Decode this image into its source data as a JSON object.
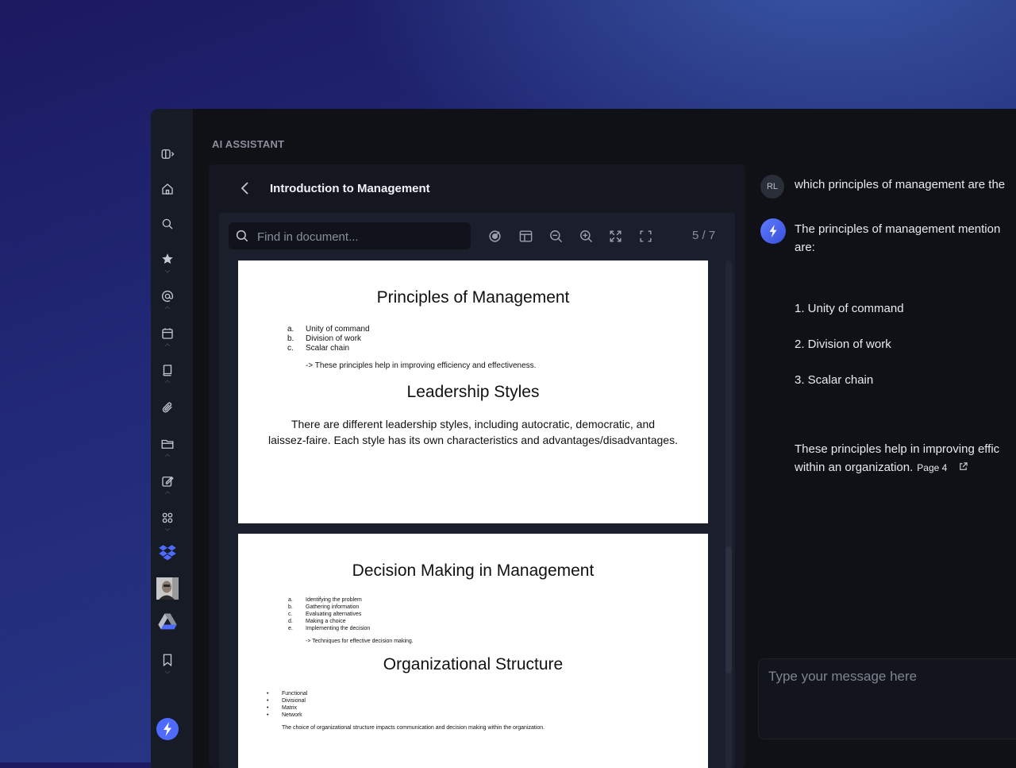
{
  "app_title": "AI ASSISTANT",
  "sidebar": {
    "items": [
      {
        "icon": "sidebar-toggle-icon"
      },
      {
        "icon": "home-icon"
      },
      {
        "icon": "search-icon"
      },
      {
        "icon": "star-icon"
      },
      {
        "icon": "at-sign-icon"
      },
      {
        "icon": "calendar-icon"
      },
      {
        "icon": "book-icon"
      },
      {
        "icon": "paperclip-icon"
      },
      {
        "icon": "folder-icon"
      },
      {
        "icon": "edit-icon"
      },
      {
        "icon": "apps-grid-icon"
      },
      {
        "icon": "dropbox-icon"
      },
      {
        "icon": "user-avatar"
      },
      {
        "icon": "google-drive-icon"
      },
      {
        "icon": "bookmark-icon"
      },
      {
        "icon": "ai-assistant-icon"
      }
    ],
    "accent": "#4f6bff"
  },
  "document": {
    "title": "Introduction to Management",
    "search_placeholder": "Find in document...",
    "page_indicator": "5 / 7",
    "pages": [
      {
        "heading1": "Principles of Management",
        "list": [
          {
            "marker": "a.",
            "text": "Unity of command"
          },
          {
            "marker": "b.",
            "text": "Division of work"
          },
          {
            "marker": "c.",
            "text": "Scalar chain"
          }
        ],
        "note": "-> These principles help in improving efficiency and effectiveness.",
        "heading2": "Leadership Styles",
        "para_line1": "There are different leadership styles, including autocratic, democratic, and",
        "para_line2": "laissez-faire. Each style has its own characteristics and advantages/disadvantages."
      },
      {
        "heading1": "Decision Making in Management",
        "list": [
          {
            "marker": "a.",
            "text": "Identifying the problem"
          },
          {
            "marker": "b.",
            "text": "Gathering information"
          },
          {
            "marker": "c.",
            "text": "Evaluating alternatives"
          },
          {
            "marker": "d.",
            "text": "Making a choice"
          },
          {
            "marker": "e.",
            "text": "Implementing the decision"
          }
        ],
        "note": "-> Techniques for effective decision making.",
        "heading2": "Organizational Structure",
        "bullets": [
          "Functional",
          "Divisional",
          "Matrix",
          "Network"
        ],
        "closing": "The choice of organizational structure impacts communication and decision making within the organization."
      }
    ]
  },
  "chat": {
    "user_initials": "RL",
    "user_message": "which principles of management are the",
    "ai_intro_line1": "The principles of management mention",
    "ai_intro_line2": "are:",
    "ai_items": [
      "1. Unity of command",
      "2. Division of work",
      "3. Scalar chain"
    ],
    "ai_outro_line1": "These principles help in improving effic",
    "ai_outro_line2": "within an organization.",
    "page_ref": "Page 4",
    "input_placeholder": "Type your message here"
  }
}
